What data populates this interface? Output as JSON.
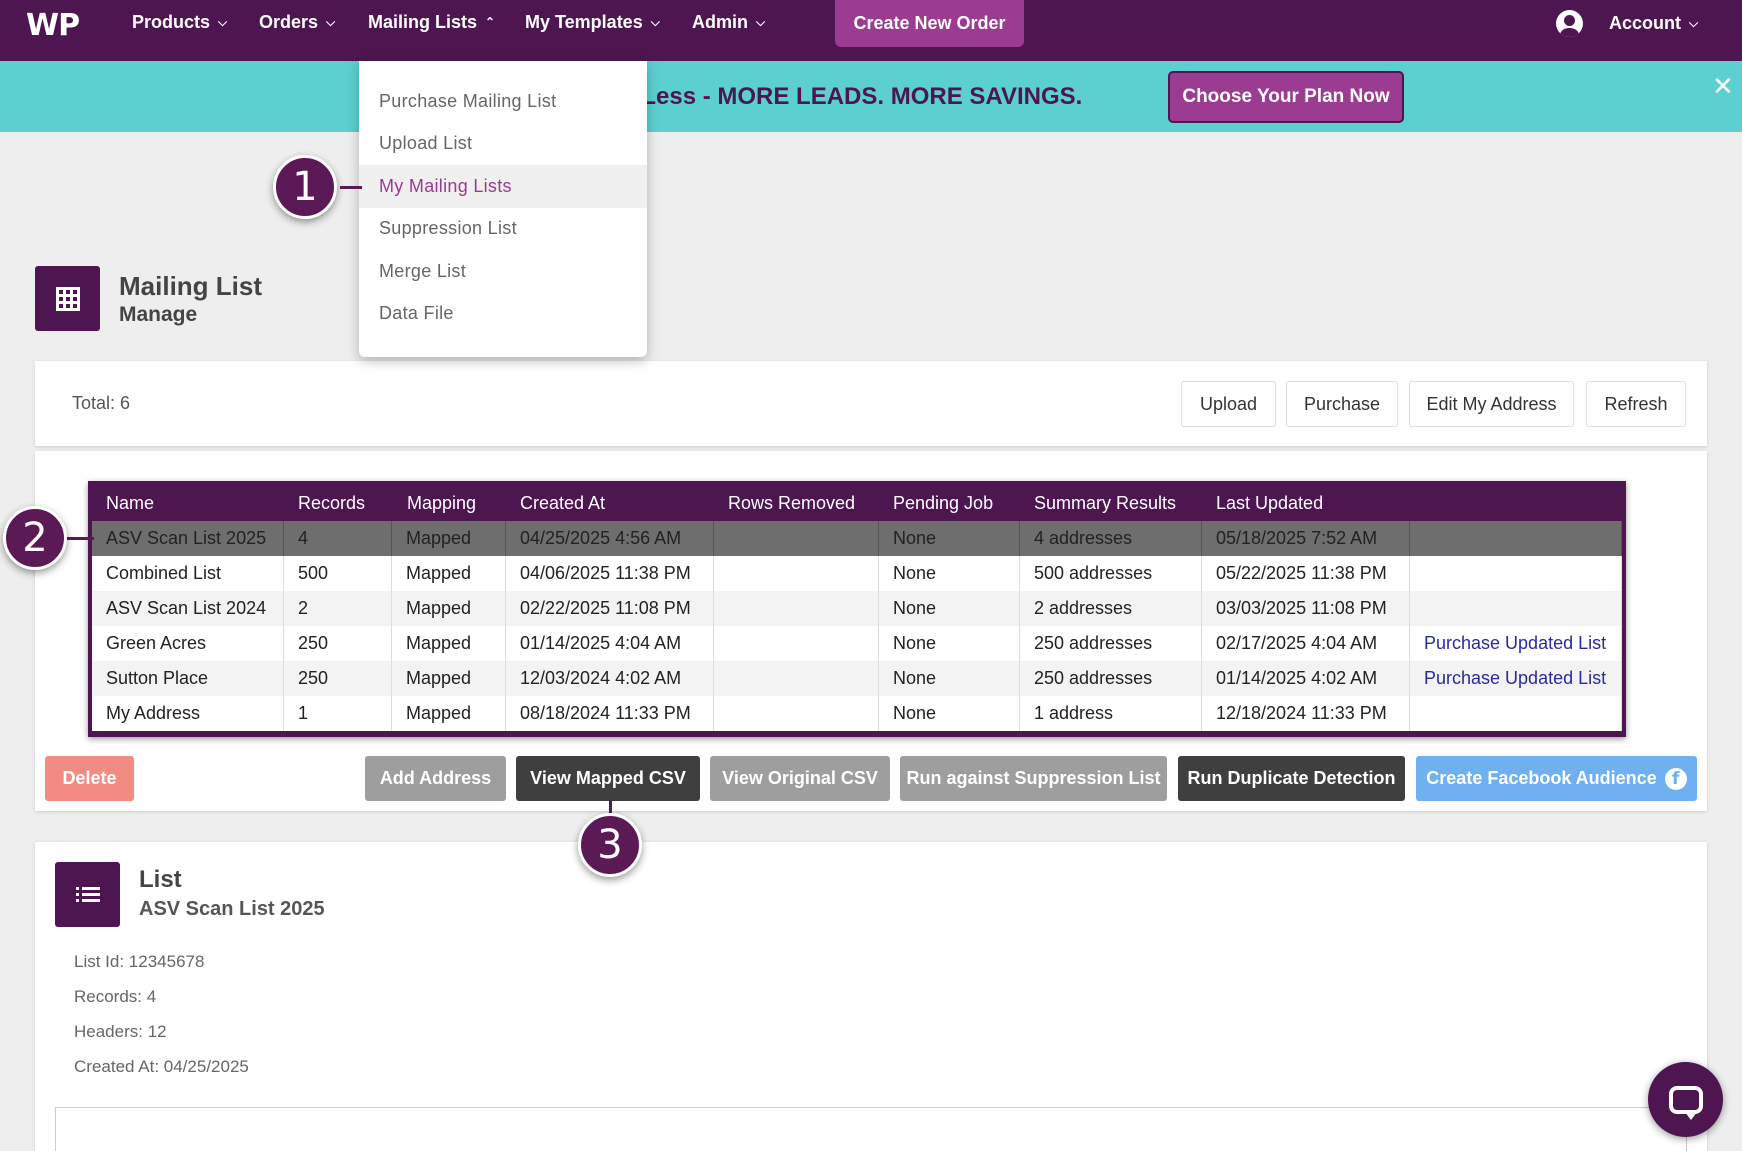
{
  "nav": {
    "logo": "WP",
    "items": [
      {
        "label": "Products",
        "chevron": "⌵"
      },
      {
        "label": "Orders",
        "chevron": "⌵"
      },
      {
        "label": "Mailing Lists",
        "chevron": "⌃"
      },
      {
        "label": "My Templates",
        "chevron": "⌵"
      },
      {
        "label": "Admin",
        "chevron": "⌵"
      }
    ],
    "create_order": "Create New Order",
    "account": "Account",
    "account_chevron": "⌵"
  },
  "banner": {
    "text": "re, For Less - MORE LEADS. MORE SAVINGS.",
    "button": "Choose Your Plan Now",
    "close": "✕"
  },
  "dropdown": {
    "items": [
      "Purchase Mailing List",
      "Upload List",
      "My Mailing Lists",
      "Suppression List",
      "Merge List",
      "Data File"
    ],
    "active": "My Mailing Lists"
  },
  "callouts": [
    "1",
    "2",
    "3"
  ],
  "header": {
    "title": "Mailing List",
    "subtitle": "Manage"
  },
  "toolbar": {
    "total": "Total: 6",
    "buttons": [
      "Upload",
      "Purchase",
      "Edit My Address",
      "Refresh"
    ]
  },
  "table": {
    "columns": [
      "Name",
      "Records",
      "Mapping",
      "Created At",
      "Rows Removed",
      "Pending Job",
      "Summary Results",
      "Last Updated",
      ""
    ],
    "rows": [
      [
        "ASV Scan List 2025",
        "4",
        "Mapped",
        "04/25/2025 4:56 AM",
        "",
        "None",
        "4 addresses",
        "05/18/2025 7:52 AM",
        ""
      ],
      [
        "Combined List",
        "500",
        "Mapped",
        "04/06/2025 11:38 PM",
        "",
        "None",
        "500 addresses",
        "05/22/2025 11:38 PM",
        ""
      ],
      [
        "ASV Scan List 2024",
        "2",
        "Mapped",
        "02/22/2025 11:08 PM",
        "",
        "None",
        "2 addresses",
        "03/03/2025 11:08 PM",
        ""
      ],
      [
        "Green Acres",
        "250",
        "Mapped",
        "01/14/2025 4:04 AM",
        "",
        "None",
        "250 addresses",
        "02/17/2025 4:04 AM",
        "Purchase Updated List"
      ],
      [
        "Sutton Place",
        "250",
        "Mapped",
        "12/03/2024 4:02 AM",
        "",
        "None",
        "250 addresses",
        "01/14/2025 4:02 AM",
        "Purchase Updated List"
      ],
      [
        "My Address",
        "1",
        "Mapped",
        "08/18/2024 11:33 PM",
        "",
        "None",
        "1 address",
        "12/18/2024 11:33 PM",
        ""
      ]
    ],
    "selected_row": 0
  },
  "actions": {
    "delete": "Delete",
    "add_address": "Add Address",
    "view_mapped": "View Mapped CSV",
    "view_original": "View Original CSV",
    "run_suppression": "Run against Suppression List",
    "run_duplicate": "Run Duplicate Detection",
    "facebook": "Create Facebook Audience"
  },
  "details": {
    "title": "List",
    "subtitle": "ASV Scan List 2025",
    "list_id": "List Id: 12345678",
    "records": "Records: 4",
    "headers": "Headers: 12",
    "created_at": "Created At: 04/25/2025"
  },
  "colors": {
    "brand": "#4d1650",
    "accent": "#9b3b91",
    "banner": "#5ccfd1",
    "delete": "#f28b82",
    "facebook": "#6fb0f0"
  }
}
